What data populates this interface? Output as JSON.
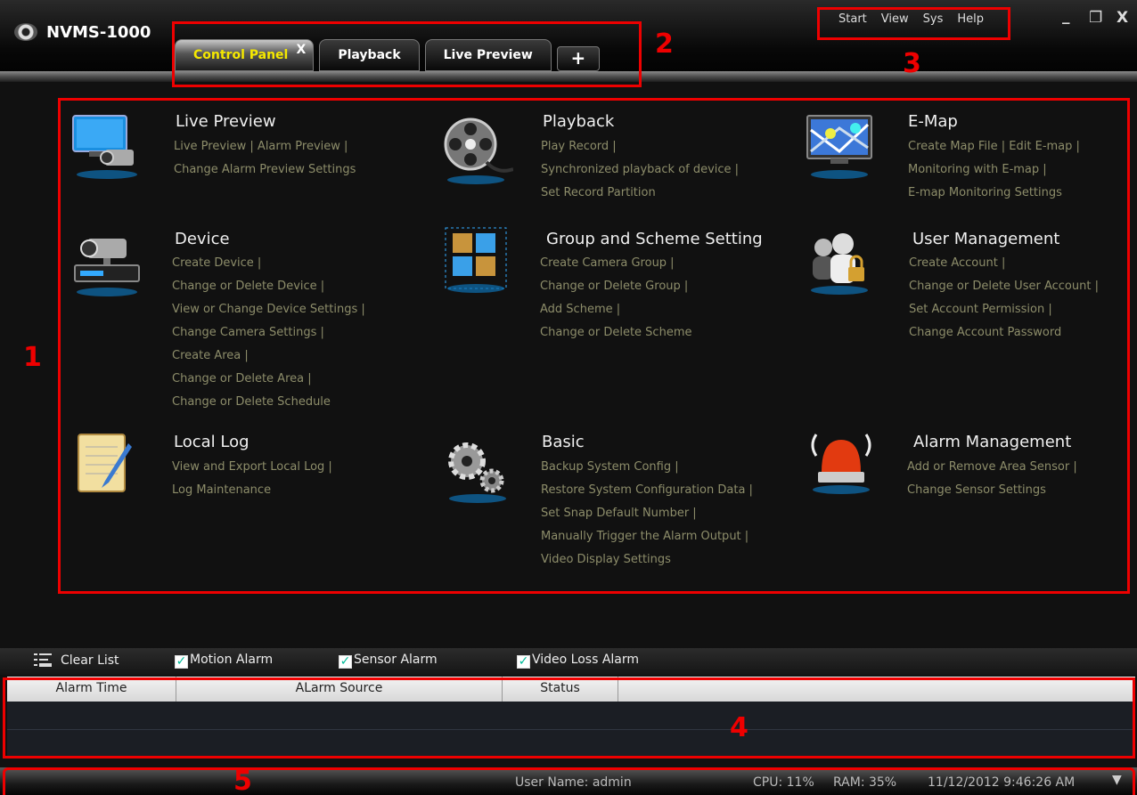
{
  "app": {
    "title": "NVMS-1000"
  },
  "tabs": [
    {
      "label": "Control Panel",
      "close": "X"
    },
    {
      "label": "Playback"
    },
    {
      "label": "Live Preview"
    },
    {
      "label": "+"
    }
  ],
  "menu": [
    "Start",
    "View",
    "Sys",
    "Help"
  ],
  "window_controls": {
    "minimize": "_",
    "restore": "❐",
    "close": "X"
  },
  "annotations": [
    "1",
    "2",
    "3",
    "4",
    "5"
  ],
  "sections": [
    {
      "title": "Live Preview",
      "icon": "monitor-camera-icon",
      "links": [
        "Live Preview  |  Alarm Preview  |",
        "Change Alarm Preview Settings"
      ]
    },
    {
      "title": "Playback",
      "icon": "film-reel-icon",
      "links": [
        "Play Record  |",
        "Synchronized playback of device  |",
        "Set Record Partition"
      ]
    },
    {
      "title": "E-Map",
      "icon": "map-monitor-icon",
      "links": [
        "Create Map File  |  Edit E-map  |",
        "Monitoring with E-map  |",
        "E-map Monitoring Settings"
      ]
    },
    {
      "title": "Device",
      "icon": "device-camera-icon",
      "links": [
        "Create Device  |",
        "Change or Delete Device  |",
        "View or Change Device Settings  |",
        "Change Camera Settings  |",
        "Create Area  |",
        "Change or Delete Area  |",
        "Change or Delete Schedule"
      ]
    },
    {
      "title": "Group and Scheme Setting",
      "icon": "cube-group-icon",
      "links": [
        "Create Camera Group  |",
        "Change or Delete Group  |",
        "Add Scheme  |",
        "Change or Delete Scheme"
      ]
    },
    {
      "title": "User Management",
      "icon": "users-lock-icon",
      "links": [
        "Create Account  |",
        "Change or Delete User Account  |",
        "Set Account Permission  |",
        "Change Account Password"
      ]
    },
    {
      "title": "Local Log",
      "icon": "notepad-icon",
      "links": [
        "View and Export Local Log  |",
        "Log Maintenance"
      ]
    },
    {
      "title": "Basic",
      "icon": "gears-icon",
      "links": [
        "Backup System Config  |",
        "Restore System Configuration Data  |",
        "Set Snap Default Number  |",
        "Manually Trigger the Alarm Output  |",
        "Video Display Settings"
      ]
    },
    {
      "title": "Alarm Management",
      "icon": "alarm-light-icon",
      "links": [
        "Add or Remove Area Sensor  |",
        "Change Sensor Settings"
      ]
    }
  ],
  "alarm_toolbar": {
    "clear_list": "Clear List",
    "motion": "Motion Alarm",
    "sensor": "Sensor Alarm",
    "video_loss": "Video Loss Alarm",
    "checked": true
  },
  "alarm_table": {
    "columns": [
      "Alarm Time",
      "ALarm Source",
      "Status",
      ""
    ],
    "rows": []
  },
  "status": {
    "user": "User Name: admin",
    "cpu": "CPU: 11%",
    "ram": "RAM: 35%",
    "datetime": "11/12/2012 9:46:26 AM"
  },
  "colors": {
    "annotation": "#e00000",
    "active_tab_text": "#f5e800",
    "link": "#8d8d6a"
  }
}
